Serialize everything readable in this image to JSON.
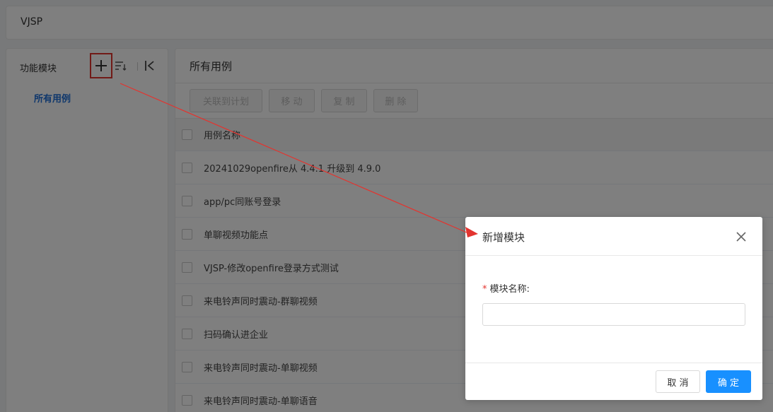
{
  "header": {
    "title": "VJSP"
  },
  "sidebar": {
    "title": "功能模块",
    "tree": [
      {
        "label": "所有用例"
      }
    ]
  },
  "main": {
    "title": "所有用例",
    "toolbar": [
      {
        "label": "关联到计划"
      },
      {
        "label": "移 动"
      },
      {
        "label": "复 制"
      },
      {
        "label": "删 除"
      }
    ],
    "table": {
      "header": "用例名称",
      "rows": [
        "20241029openfire从 4.4.1 升级到 4.9.0",
        "app/pc同账号登录",
        "单聊视频功能点",
        "VJSP-修改openfire登录方式测试",
        "来电铃声同时震动-群聊视频",
        "扫码确认进企业",
        "来电铃声同时震动-单聊视频",
        "来电铃声同时震动-单聊语音"
      ]
    }
  },
  "dialog": {
    "title": "新增模块",
    "required_mark": "*",
    "field_label": "模块名称:",
    "field_value": "",
    "cancel_label": "取 消",
    "ok_label": "确 定"
  },
  "colors": {
    "accent": "#1890ff",
    "highlight_red": "#e3342f",
    "tree_active": "#1e6fd9"
  }
}
